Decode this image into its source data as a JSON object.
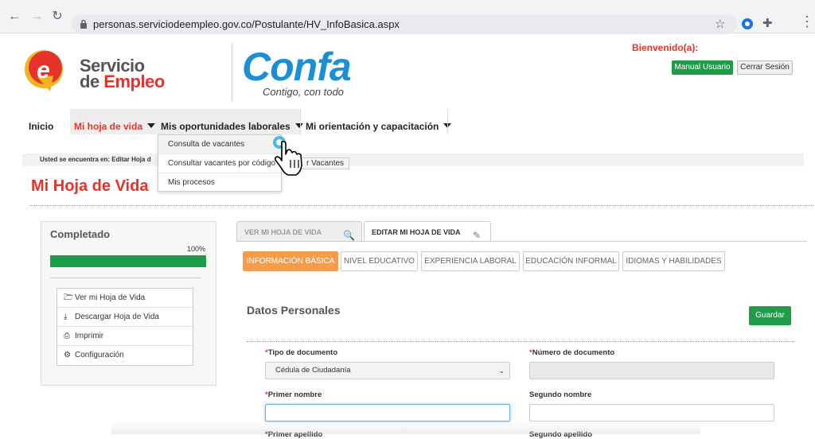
{
  "browser": {
    "url": "personas.serviciodeempleo.gov.co/Postulante/HV_InfoBasica.aspx"
  },
  "header": {
    "logo_line1": "Servicio",
    "logo_line2a": "de ",
    "logo_line2b": "Empleo",
    "confa_logo": "Confa",
    "confa_tagline": "Contigo, con todo",
    "welcome": "Bienvenido(a):",
    "manual_button": "Manual Usuario",
    "logout_button": "Cerrar Sesión"
  },
  "nav": {
    "items": [
      {
        "label": "Inicio"
      },
      {
        "label": "Mi hoja de vida"
      },
      {
        "label": "Mis oportunidades laborales"
      },
      {
        "label": "Mi orientación y capacitación"
      }
    ],
    "dropdown": [
      {
        "label": "Consulta de vacantes"
      },
      {
        "label": "Consultar vacantes por código"
      },
      {
        "label": "Mis procesos"
      }
    ],
    "tooltip": "r Vacantes"
  },
  "breadcrumb": "Usted se encuentra en:  Editar Hoja d",
  "page_title": "Mi Hoja de Vida",
  "sidebar": {
    "title": "Completado",
    "percent_label": "100%",
    "progress_fraction": 1.0,
    "items": [
      {
        "label": "Ver mi Hoja de Vida",
        "icon": "folder-open-icon"
      },
      {
        "label": "Descargar Hoja de Vida",
        "icon": "download-icon"
      },
      {
        "label": "Imprimir",
        "icon": "print-icon"
      },
      {
        "label": "Configuración",
        "icon": "gear-icon"
      }
    ]
  },
  "tabs": [
    {
      "label": "VER MI HOJA DE VIDA",
      "icon": "search-doc-icon"
    },
    {
      "label": "EDITAR MI HOJA DE VIDA",
      "icon": "edit-icon"
    }
  ],
  "subtabs": [
    {
      "label": "INFORMACIÓN BÁSICA"
    },
    {
      "label": "NIVEL EDUCATIVO"
    },
    {
      "label": "EXPERIENCIA LABORAL"
    },
    {
      "label": "EDUCACIÓN INFORMAL"
    },
    {
      "label": "IDIOMAS Y HABILIDADES"
    }
  ],
  "form": {
    "section_title": "Datos Personales",
    "save_button": "Guardar",
    "doc_type_label": "Tipo de documento",
    "doc_type_value": "Cédula de Ciudadanía",
    "doc_number_label": "Número de documento",
    "doc_number_value": "",
    "first_name_label": "Primer nombre",
    "first_name_value": "",
    "second_name_label": "Segundo nombre",
    "second_name_value": "",
    "required_mark": "*",
    "cut_label_1": "*Primer apellido",
    "cut_label_2": "Segundo apellido"
  },
  "colors": {
    "brand_red": "#e63329",
    "green": "#1f9c48",
    "orange_tab": "#f59b4c",
    "confa_blue": "#1b8fd6"
  }
}
